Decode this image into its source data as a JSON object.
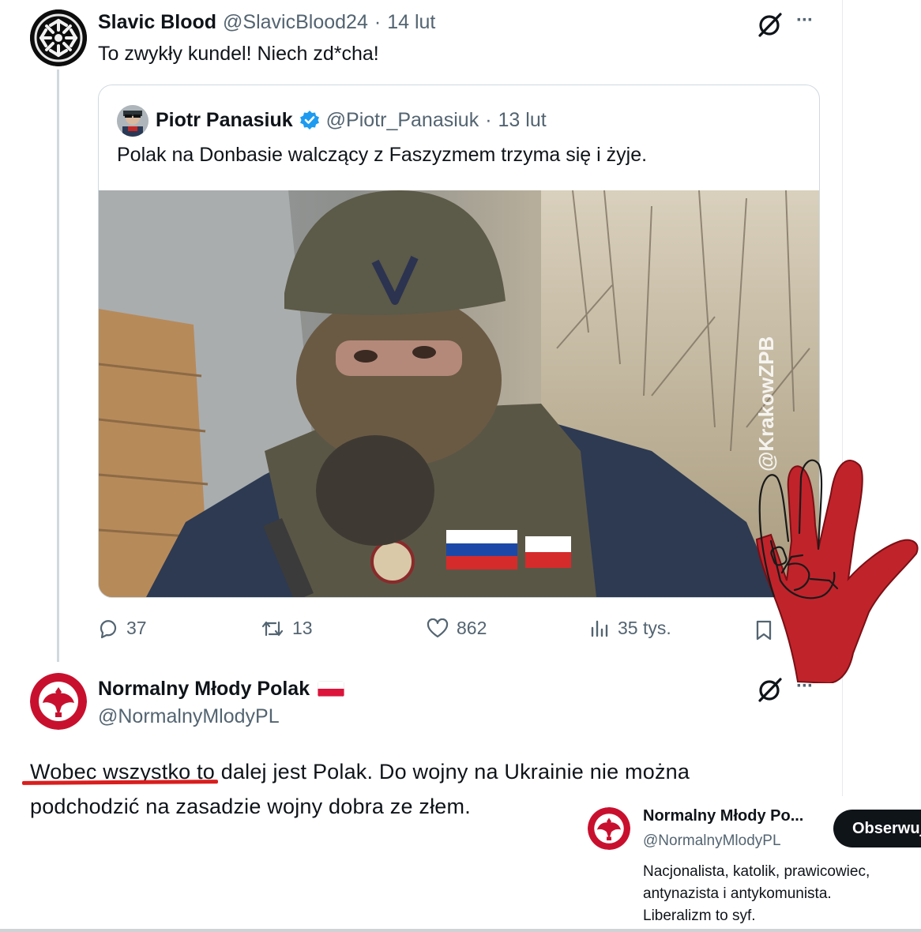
{
  "tweet1": {
    "name": "Slavic Blood",
    "handle": "@SlavicBlood24",
    "sep": "·",
    "date": "14 lut",
    "text": "To zwykły kundel! Niech zd*cha!",
    "more": "···"
  },
  "quote": {
    "name": "Piotr Panasiuk",
    "handle": "@Piotr_Panasiuk",
    "sep": "·",
    "date": "13 lut",
    "text": "Polak na Donbasie walczący z Faszyzmem trzyma się i żyje.",
    "watermark": "@KrakowZPB"
  },
  "actions": {
    "replies": "37",
    "retweets": "13",
    "likes": "862",
    "views": "35 tys."
  },
  "tweet2": {
    "name": "Normalny Młody Polak",
    "handle": "@NormalnyMlodyPL",
    "more": "···",
    "text_underlined": "Wobec wszystko",
    "text_rest": " to dalej jest Polak. Do wojny na Ukrainie nie można podchodzić na zasadzie wojny dobra ze złem."
  },
  "profile_card": {
    "name": "Normalny Młody Po...",
    "handle": "@NormalnyMlodyPL",
    "follow": "Obserwuj",
    "bio": [
      "Nacjonalista, katolik, prawicowiec,",
      "antynazista i antykomunista.",
      "Liberalizm to syf."
    ]
  },
  "colors": {
    "verified": "#1d9bf0",
    "text": "#0f1419",
    "muted": "#536471",
    "underline": "#d91e1e",
    "hand": "#c62828",
    "flag_red": "#dc143c"
  },
  "icons": [
    "grok-icon",
    "more-icon",
    "verified-icon",
    "reply-icon",
    "retweet-icon",
    "like-icon",
    "views-icon",
    "bookmark-icon",
    "hand-gesture-icon"
  ]
}
